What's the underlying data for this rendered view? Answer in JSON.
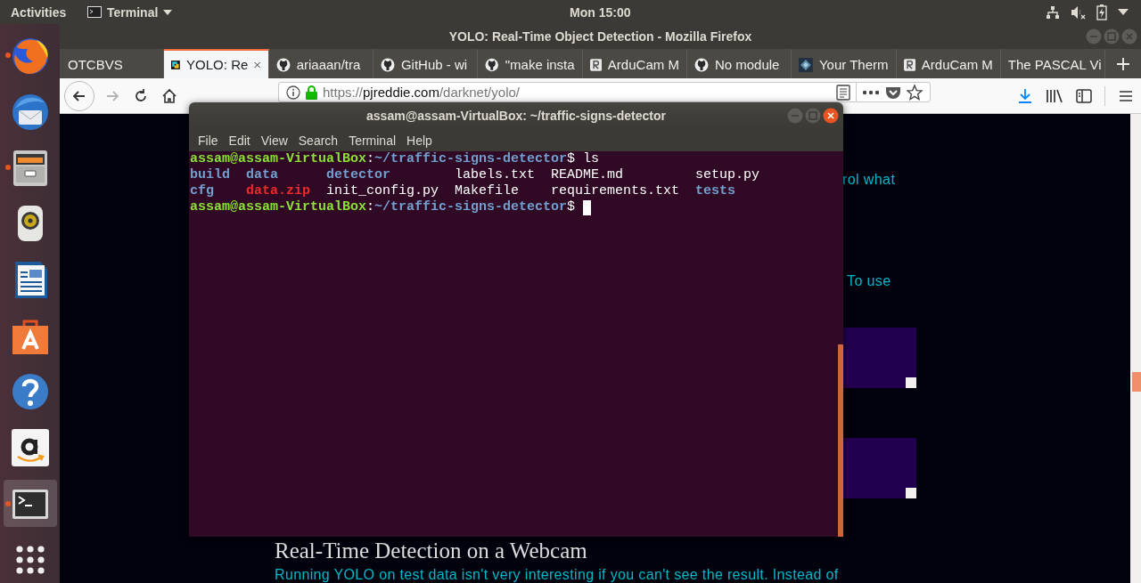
{
  "top_bar": {
    "activities": "Activities",
    "app_menu": "Terminal",
    "clock": "Mon 15:00"
  },
  "dock": [
    {
      "kind": "browser",
      "running": true,
      "selected": false
    },
    {
      "kind": "mail",
      "running": false,
      "selected": false
    },
    {
      "kind": "files",
      "running": true,
      "selected": false
    },
    {
      "kind": "speaker",
      "running": false,
      "selected": false
    },
    {
      "kind": "document",
      "running": false,
      "selected": false
    },
    {
      "kind": "bag",
      "running": false,
      "selected": false
    },
    {
      "kind": "help",
      "running": false,
      "selected": false
    },
    {
      "kind": "smile",
      "running": false,
      "selected": false
    },
    {
      "kind": "terminal",
      "running": true,
      "selected": true
    },
    {
      "kind": "grid",
      "running": false,
      "selected": false
    }
  ],
  "browser": {
    "title": "YOLO: Real-Time Object Detection - Mozilla Firefox",
    "tabs": [
      {
        "label": "OTCBVS",
        "kind": "plain",
        "selected": false
      },
      {
        "label": "YOLO: Re",
        "kind": "yolo",
        "selected": true
      },
      {
        "label": "ariaaan/tra",
        "kind": "octocat",
        "selected": false
      },
      {
        "label": "GitHub - wi",
        "kind": "octocat",
        "selected": false
      },
      {
        "label": "\"make insta",
        "kind": "octocat",
        "selected": false
      },
      {
        "label": "ArduCam M",
        "kind": "sketch",
        "selected": false
      },
      {
        "label": "No module",
        "kind": "octocat",
        "selected": false
      },
      {
        "label": "Your Therm",
        "kind": "diamond",
        "selected": false
      },
      {
        "label": "ArduCam M",
        "kind": "sketch",
        "selected": false
      },
      {
        "label": "The PASCAL Vi",
        "kind": "plain",
        "selected": false
      }
    ],
    "nav": [
      {
        "kind": "back",
        "disabled": false
      },
      {
        "kind": "forward",
        "disabled": true
      },
      {
        "kind": "reload",
        "disabled": false
      },
      {
        "kind": "home",
        "disabled": false
      }
    ],
    "url": {
      "scheme": "https://",
      "host": "pjreddie.com",
      "path": "/darknet/yolo/"
    },
    "page": {
      "fragments": [
        "rol what",
        "To use"
      ],
      "heading": "Real-Time Detection on a Webcam",
      "paragraph": "Running YOLO on test data isn't very interesting if you can't see the result. Instead of"
    }
  },
  "terminal": {
    "title": "assam@assam-VirtualBox: ~/traffic-signs-detector",
    "menu": [
      "File",
      "Edit",
      "View",
      "Search",
      "Terminal",
      "Help"
    ],
    "lines": [
      {
        "kind": "prompt",
        "cursor": false,
        "segments": [
          {
            "kind": "user",
            "text": "assam@assam-VirtualBox"
          },
          {
            "kind": "plain",
            "text": ":"
          },
          {
            "kind": "path",
            "text": "~/traffic-signs-detector"
          },
          {
            "kind": "plain",
            "text": "$ ls"
          }
        ]
      },
      {
        "kind": "listing",
        "entries": [
          {
            "name": "build",
            "kind": "dir"
          },
          {
            "name": "data",
            "kind": "dir"
          },
          {
            "name": "detector",
            "kind": "dir"
          },
          {
            "name": "labels.txt",
            "kind": "file"
          },
          {
            "name": "README.md",
            "kind": "file"
          },
          {
            "name": "setup.py",
            "kind": "file"
          }
        ]
      },
      {
        "kind": "listing",
        "entries": [
          {
            "name": "cfg",
            "kind": "dir"
          },
          {
            "name": "data.zip",
            "kind": "archive"
          },
          {
            "name": "init_config.py",
            "kind": "file"
          },
          {
            "name": "Makefile",
            "kind": "file"
          },
          {
            "name": "requirements.txt",
            "kind": "file"
          },
          {
            "name": "tests",
            "kind": "dir"
          }
        ]
      },
      {
        "kind": "prompt",
        "cursor": true,
        "segments": [
          {
            "kind": "user",
            "text": "assam@assam-VirtualBox"
          },
          {
            "kind": "plain",
            "text": ":"
          },
          {
            "kind": "path",
            "text": "~/traffic-signs-detector"
          },
          {
            "kind": "plain",
            "text": "$ "
          }
        ]
      }
    ]
  }
}
